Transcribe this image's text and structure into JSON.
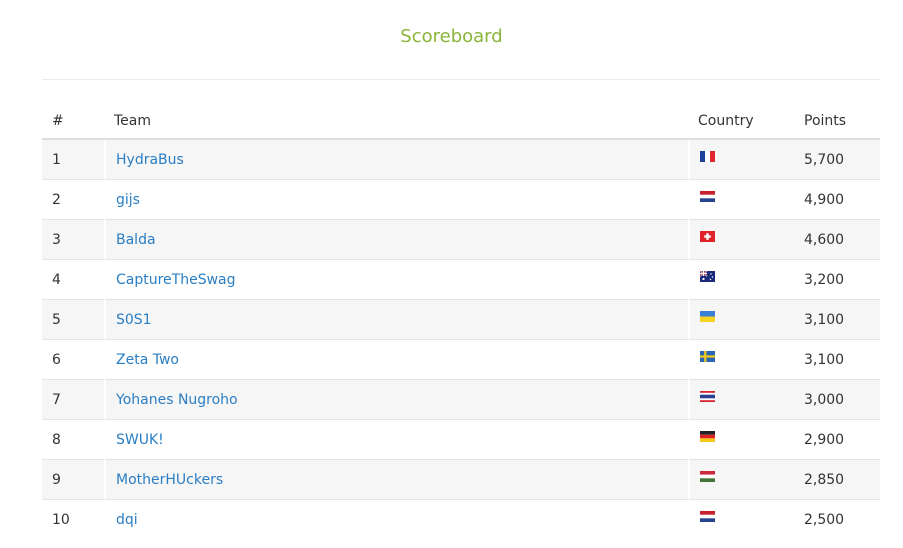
{
  "page": {
    "title": "Scoreboard"
  },
  "table": {
    "headers": {
      "rank": "#",
      "team": "Team",
      "country": "Country",
      "points": "Points"
    },
    "rows": [
      {
        "rank": "1",
        "team": "HydraBus",
        "country": "France",
        "flag": "fr",
        "points": "5,700"
      },
      {
        "rank": "2",
        "team": "gijs",
        "country": "Netherlands",
        "flag": "nl",
        "points": "4,900"
      },
      {
        "rank": "3",
        "team": "Balda",
        "country": "Switzerland",
        "flag": "ch",
        "points": "4,600"
      },
      {
        "rank": "4",
        "team": "CaptureTheSwag",
        "country": "Australia",
        "flag": "au",
        "points": "3,200"
      },
      {
        "rank": "5",
        "team": "S0S1",
        "country": "Ukraine",
        "flag": "ua",
        "points": "3,100"
      },
      {
        "rank": "6",
        "team": "Zeta Two",
        "country": "Sweden",
        "flag": "se",
        "points": "3,100"
      },
      {
        "rank": "7",
        "team": "Yohanes Nugroho",
        "country": "Thailand",
        "flag": "th",
        "points": "3,000"
      },
      {
        "rank": "8",
        "team": "SWUK!",
        "country": "Germany",
        "flag": "de",
        "points": "2,900"
      },
      {
        "rank": "9",
        "team": "MotherHUckers",
        "country": "Hungary",
        "flag": "hu",
        "points": "2,850"
      },
      {
        "rank": "10",
        "team": "dqi",
        "country": "Netherlands",
        "flag": "nl",
        "points": "2,500"
      }
    ]
  },
  "colors": {
    "title": "#8ab43a",
    "link": "#2a7ec4",
    "stripe": "#f6f6f6"
  }
}
